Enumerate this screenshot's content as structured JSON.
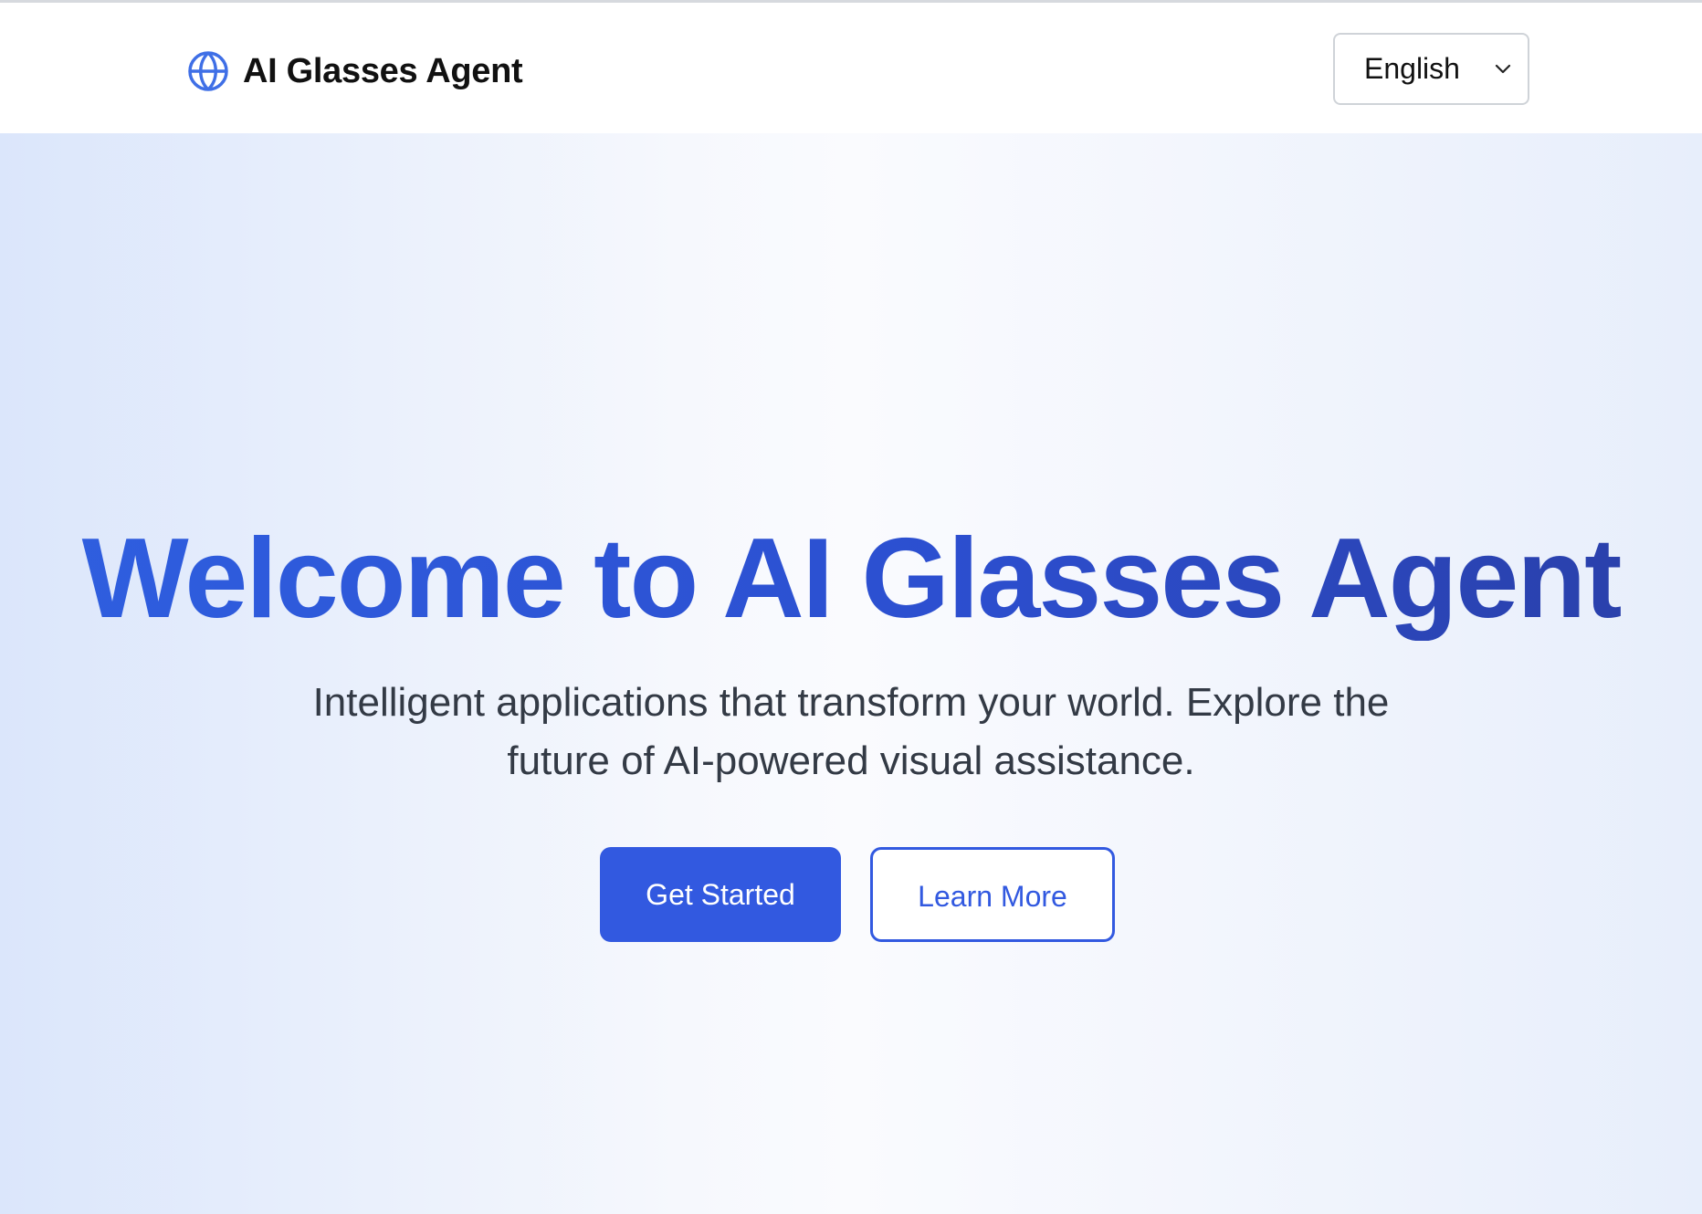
{
  "header": {
    "brand_icon": "globe-icon",
    "brand_title": "AI Glasses Agent",
    "language": {
      "selected": "English",
      "icon": "chevron-down-icon"
    }
  },
  "hero": {
    "title": "Welcome to AI Glasses Agent",
    "subtitle": "Intelligent applications that transform your world. Explore the future of AI-powered visual assistance.",
    "primary_button": "Get Started",
    "secondary_button": "Learn More"
  },
  "colors": {
    "accent": "#3259e0",
    "title_gradient_end": "#2a3fa8",
    "text_dark": "#111111",
    "subtitle_text": "#333a45"
  }
}
